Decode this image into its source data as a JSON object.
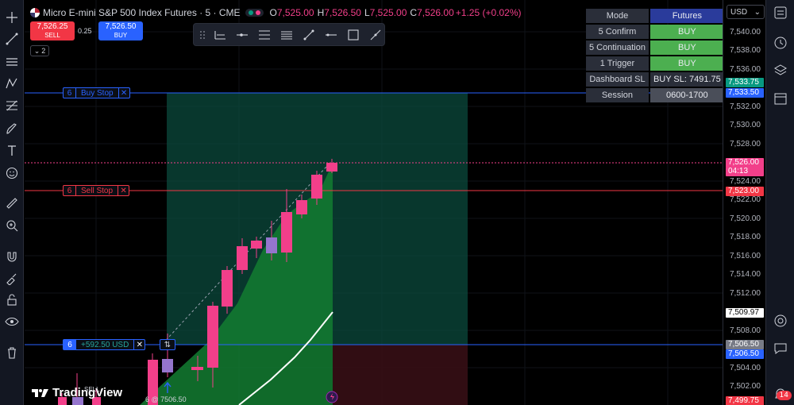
{
  "header": {
    "symbol_title": "Micro E-mini S&P 500 Index Futures · 5 · CME",
    "ohlc": {
      "o_label": "O",
      "o_value": "7,525.00",
      "h_label": "H",
      "h_value": "7,526.50",
      "l_label": "L",
      "l_value": "7,525.00",
      "c_label": "C",
      "c_value": "7,526.00",
      "change": "+1.25 (+0.02%)"
    }
  },
  "trade_panel": {
    "sell_price": "7,526.25",
    "sell_label": "SELL",
    "spread": "0.25",
    "buy_price": "7,526.50",
    "buy_label": "BUY",
    "collapse_count": "2"
  },
  "info_table": {
    "rows": [
      {
        "key": "Mode",
        "value": "Futures",
        "value_color": "#2a3b9b"
      },
      {
        "key": "5 Confirm",
        "value": "BUY",
        "value_color": "#4caf50"
      },
      {
        "key": "5 Continuation",
        "value": "BUY",
        "value_color": "#4caf50"
      },
      {
        "key": "1 Trigger",
        "value": "BUY",
        "value_color": "#4caf50"
      },
      {
        "key": "Dashboard SL",
        "value": "BUY SL: 7491.75",
        "value_color": "#2a2e39"
      },
      {
        "key": "Session",
        "value": "0600-1700",
        "value_color": "#4a4e59"
      }
    ]
  },
  "orders": {
    "buy_stop": {
      "qty": "6",
      "label": "Buy Stop",
      "close": "✕"
    },
    "sell_stop": {
      "qty": "6",
      "label": "Sell Stop",
      "close": "✕"
    },
    "position": {
      "qty": "6",
      "pnl": "+592.50 USD",
      "close": "✕",
      "reverse": "⇅"
    }
  },
  "price_scale": {
    "currency": "USD",
    "ticks": [
      "7,540.00",
      "7,538.00",
      "7,536.00",
      "7,532.00",
      "7,530.00",
      "7,528.00",
      "7,524.00",
      "7,522.00",
      "7,520.00",
      "7,518.00",
      "7,516.00",
      "7,514.00",
      "7,512.00",
      "7,508.00",
      "7,504.00",
      "7,502.00"
    ],
    "tags": [
      {
        "text": "7,533.75",
        "color": "#089981"
      },
      {
        "text": "7,533.50",
        "color": "#2962ff"
      },
      {
        "text": "7,526.00",
        "color": "#f23f8a"
      },
      {
        "text": "04:13",
        "color": "#f23f8a"
      },
      {
        "text": "7,523.00",
        "color": "#f23645"
      },
      {
        "text": "7,509.97",
        "color": "#ffffff"
      },
      {
        "text": "7,506.50",
        "color": "#787b86"
      },
      {
        "text": "7,506.50",
        "color": "#2962ff"
      },
      {
        "text": "7,499.75",
        "color": "#f23645"
      }
    ]
  },
  "footer": {
    "watermark": "TradingView",
    "fill_label": "6 @ 7506.50",
    "sell_marker": "SELL"
  },
  "right_toolbar": {
    "notification_count": "14"
  }
}
